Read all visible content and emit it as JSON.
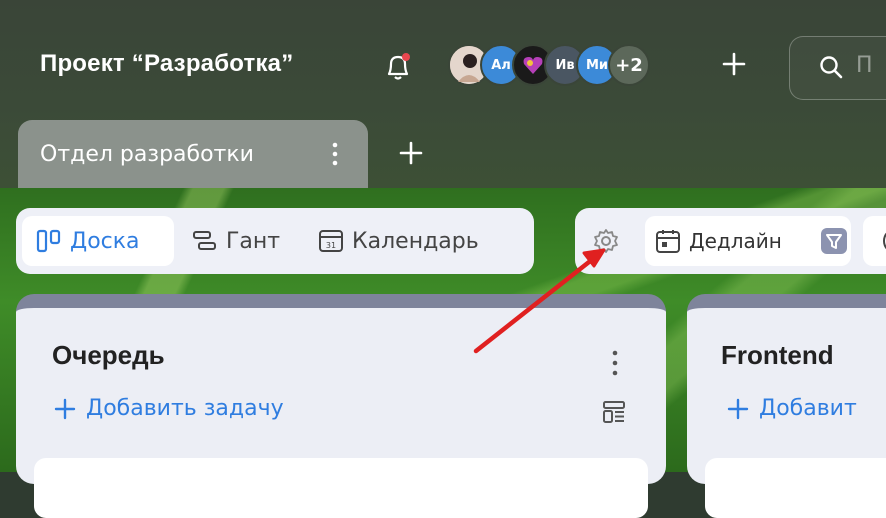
{
  "project": {
    "title": "Проект “Разработка”"
  },
  "avatars": [
    {
      "initials": "",
      "color": "#d9c6b8",
      "kind": "photo"
    },
    {
      "initials": "Ал",
      "color": "#3c8ad8",
      "kind": "text"
    },
    {
      "initials": "",
      "color": "#1a1a1a",
      "kind": "emoji"
    },
    {
      "initials": "Ив",
      "color": "#4a5662",
      "kind": "text"
    },
    {
      "initials": "Ми",
      "color": "#3c8ad8",
      "kind": "text"
    },
    {
      "initials": "+2",
      "color": "#5c685a",
      "kind": "text"
    }
  ],
  "search": {
    "placeholder": "П"
  },
  "tabs": [
    {
      "label": "Отдел разработки"
    }
  ],
  "views": [
    {
      "label": "Доска",
      "icon": "board-icon",
      "active": true
    },
    {
      "label": "Гант",
      "icon": "gantt-icon",
      "active": false
    },
    {
      "label": "Календарь",
      "icon": "calendar-icon",
      "active": false
    }
  ],
  "toolbar": {
    "deadline_label": "Дедлайн"
  },
  "columns": [
    {
      "title": "Очередь",
      "add_label": "Добавить задачу"
    },
    {
      "title": "Frontend",
      "add_label": "Добавит"
    }
  ],
  "colors": {
    "accent": "#2f7de0",
    "arrow": "#e02020",
    "notification_dot": "#e8474f"
  }
}
